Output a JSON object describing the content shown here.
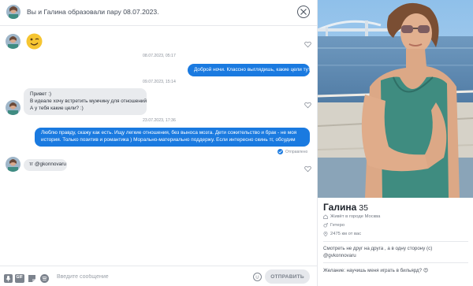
{
  "chat": {
    "header_title": "Вы и Галина образовали пару 08.07.2023.",
    "timestamps": [
      "08.07.2023, 05:17",
      "09.07.2023, 15:14",
      "23.07.2023, 17:36"
    ],
    "messages": [
      {
        "from": "partner",
        "text": "😉"
      },
      {
        "from": "me",
        "text": "Доброй ночи. Классно выглядишь, какие цели тут?"
      },
      {
        "from": "partner",
        "lines": [
          "Привет :)",
          "В идеале хочу встретить мужчину для отношений",
          "А у тебя какие цели? :)"
        ]
      },
      {
        "from": "me",
        "lines": [
          "Люблю правду, скажу как есть. Ищу легкие отношения, без выноса мозга. Дети сожительство и брак - не моя",
          "история. Только позитив и романтика ) Морально-материально поддержу. Если интересно скинь тг, обсудим"
        ]
      },
      {
        "from": "partner",
        "text": "тг @gkonnovaru"
      }
    ],
    "status_text": "Отправлено"
  },
  "composer": {
    "placeholder": "Введите сообщение",
    "value": "",
    "send_label": "ОТПРАВИТЬ",
    "gif_label": "GIF"
  },
  "profile": {
    "name": "Галина",
    "age": "35",
    "location": "Живёт в городе Москва",
    "orientation": "Гетеро",
    "distance": "2475 км от вас",
    "bio": [
      "Смотреть не друг на друга , а в одну сторону (с)",
      "@gvkonnovaru"
    ],
    "wish": "Желание: научишь меня играть в бильярд? 😍"
  },
  "colors": {
    "outgoing_bubble": "#1a7ae0",
    "incoming_bubble": "#e9ebee",
    "divider": "#e6e8ec"
  },
  "icons": [
    "close-icon",
    "heart-icon",
    "mic-icon",
    "gif-icon",
    "sticker-icon",
    "spotify-icon",
    "emoji-icon",
    "home-icon",
    "gender-icon",
    "location-pin-icon"
  ]
}
